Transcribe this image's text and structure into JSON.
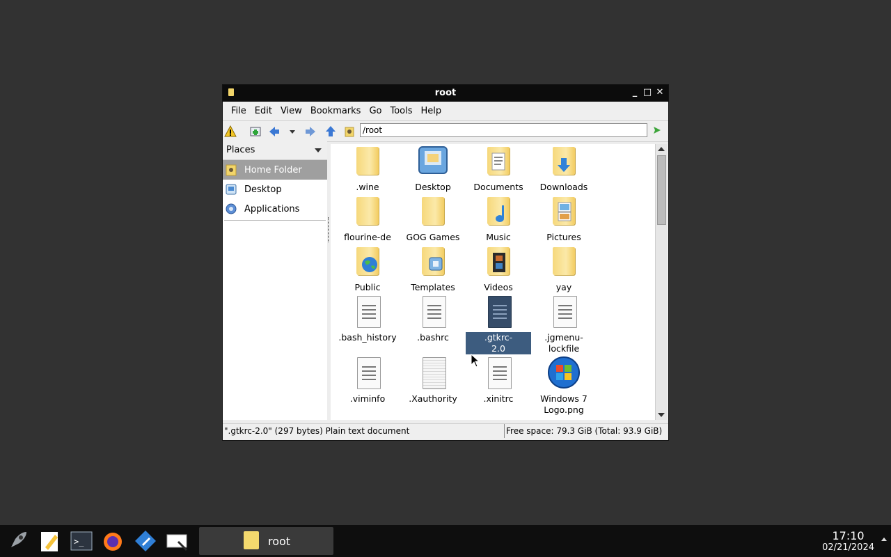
{
  "window": {
    "title": "root"
  },
  "menu": [
    "File",
    "Edit",
    "View",
    "Bookmarks",
    "Go",
    "Tools",
    "Help"
  ],
  "toolbar": {
    "address": "/root"
  },
  "sidebar": {
    "header": "Places",
    "items": [
      {
        "label": "Home Folder",
        "selected": true
      },
      {
        "label": "Desktop",
        "selected": false
      },
      {
        "label": "Applications",
        "selected": false
      }
    ]
  },
  "files": [
    {
      "label": ".wine",
      "kind": "folder"
    },
    {
      "label": "Desktop",
      "kind": "special-desktop"
    },
    {
      "label": "Documents",
      "kind": "folder-docs"
    },
    {
      "label": "Downloads",
      "kind": "folder-down"
    },
    {
      "label": "flourine-de",
      "kind": "folder"
    },
    {
      "label": "GOG Games",
      "kind": "folder"
    },
    {
      "label": "Music",
      "kind": "folder-music"
    },
    {
      "label": "Pictures",
      "kind": "folder-pics"
    },
    {
      "label": "Public",
      "kind": "folder-public"
    },
    {
      "label": "Templates",
      "kind": "folder-templates"
    },
    {
      "label": "Videos",
      "kind": "folder-videos"
    },
    {
      "label": "yay",
      "kind": "folder"
    },
    {
      "label": ".bash_history",
      "kind": "text"
    },
    {
      "label": ".bashrc",
      "kind": "text"
    },
    {
      "label": ".gtkrc-2.0",
      "kind": "text-selected"
    },
    {
      "label": ".jgmenu-lockfile",
      "kind": "text"
    },
    {
      "label": ".viminfo",
      "kind": "text"
    },
    {
      "label": ".Xauthority",
      "kind": "binary"
    },
    {
      "label": ".xinitrc",
      "kind": "text"
    },
    {
      "label": "Windows 7 Logo.png",
      "kind": "image"
    }
  ],
  "status": {
    "left": "\".gtkrc-2.0\" (297 bytes) Plain text document",
    "right": "Free space: 79.3 GiB (Total: 93.9 GiB)"
  },
  "taskbar": {
    "task_label": "root",
    "time": "17:10",
    "date": "02/21/2024"
  }
}
